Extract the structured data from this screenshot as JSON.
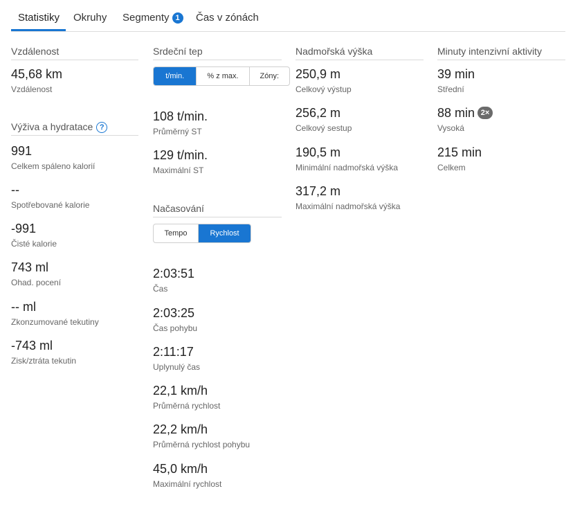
{
  "tabs": [
    {
      "label": "Statistiky"
    },
    {
      "label": "Okruhy"
    },
    {
      "label": "Segmenty",
      "badge": "1"
    },
    {
      "label": "Čas v zónách"
    }
  ],
  "distance": {
    "header": "Vzdálenost",
    "stats": [
      {
        "value": "45,68 km",
        "label": "Vzdálenost"
      }
    ]
  },
  "nutrition": {
    "header": "Výživa a hydratace",
    "help_icon": "?",
    "stats": [
      {
        "value": "991",
        "label": "Celkem spáleno kalorií"
      },
      {
        "value": "--",
        "label": "Spotřebované kalorie"
      },
      {
        "value": "-991",
        "label": "Čisté kalorie"
      },
      {
        "value": "743 ml",
        "label": "Ohad. pocení"
      },
      {
        "value": "-- ml",
        "label": "Zkonzumované tekutiny"
      },
      {
        "value": "-743 ml",
        "label": "Zisk/ztráta tekutin"
      }
    ]
  },
  "heart_rate": {
    "header": "Srdeční tep",
    "toggle": [
      "t/min.",
      "% z max.",
      "Zóny:"
    ],
    "stats": [
      {
        "value": "108 t/min.",
        "label": "Průměrný ST"
      },
      {
        "value": "129 t/min.",
        "label": "Maximální ST"
      }
    ]
  },
  "timing": {
    "header": "Načasování",
    "toggle": [
      "Tempo",
      "Rychlost"
    ],
    "stats": [
      {
        "value": "2:03:51",
        "label": "Čas"
      },
      {
        "value": "2:03:25",
        "label": "Čas pohybu"
      },
      {
        "value": "2:11:17",
        "label": "Uplynulý čas"
      },
      {
        "value": "22,1 km/h",
        "label": "Průměrná rychlost"
      },
      {
        "value": "22,2 km/h",
        "label": "Průměrná rychlost pohybu"
      },
      {
        "value": "45,0 km/h",
        "label": "Maximální rychlost"
      }
    ]
  },
  "elevation": {
    "header": "Nadmořská výška",
    "stats": [
      {
        "value": "250,9 m",
        "label": "Celkový výstup"
      },
      {
        "value": "256,2 m",
        "label": "Celkový sestup"
      },
      {
        "value": "190,5 m",
        "label": "Minimální nadmořská výška"
      },
      {
        "value": "317,2 m",
        "label": "Maximální nadmořská výška"
      }
    ]
  },
  "intensity": {
    "header": "Minuty intenzivní aktivity",
    "multiplier": "2×",
    "stats": [
      {
        "value": "39 min",
        "label": "Střední"
      },
      {
        "value": "88 min",
        "label": "Vysoká"
      },
      {
        "value": "215 min",
        "label": "Celkem"
      }
    ]
  }
}
